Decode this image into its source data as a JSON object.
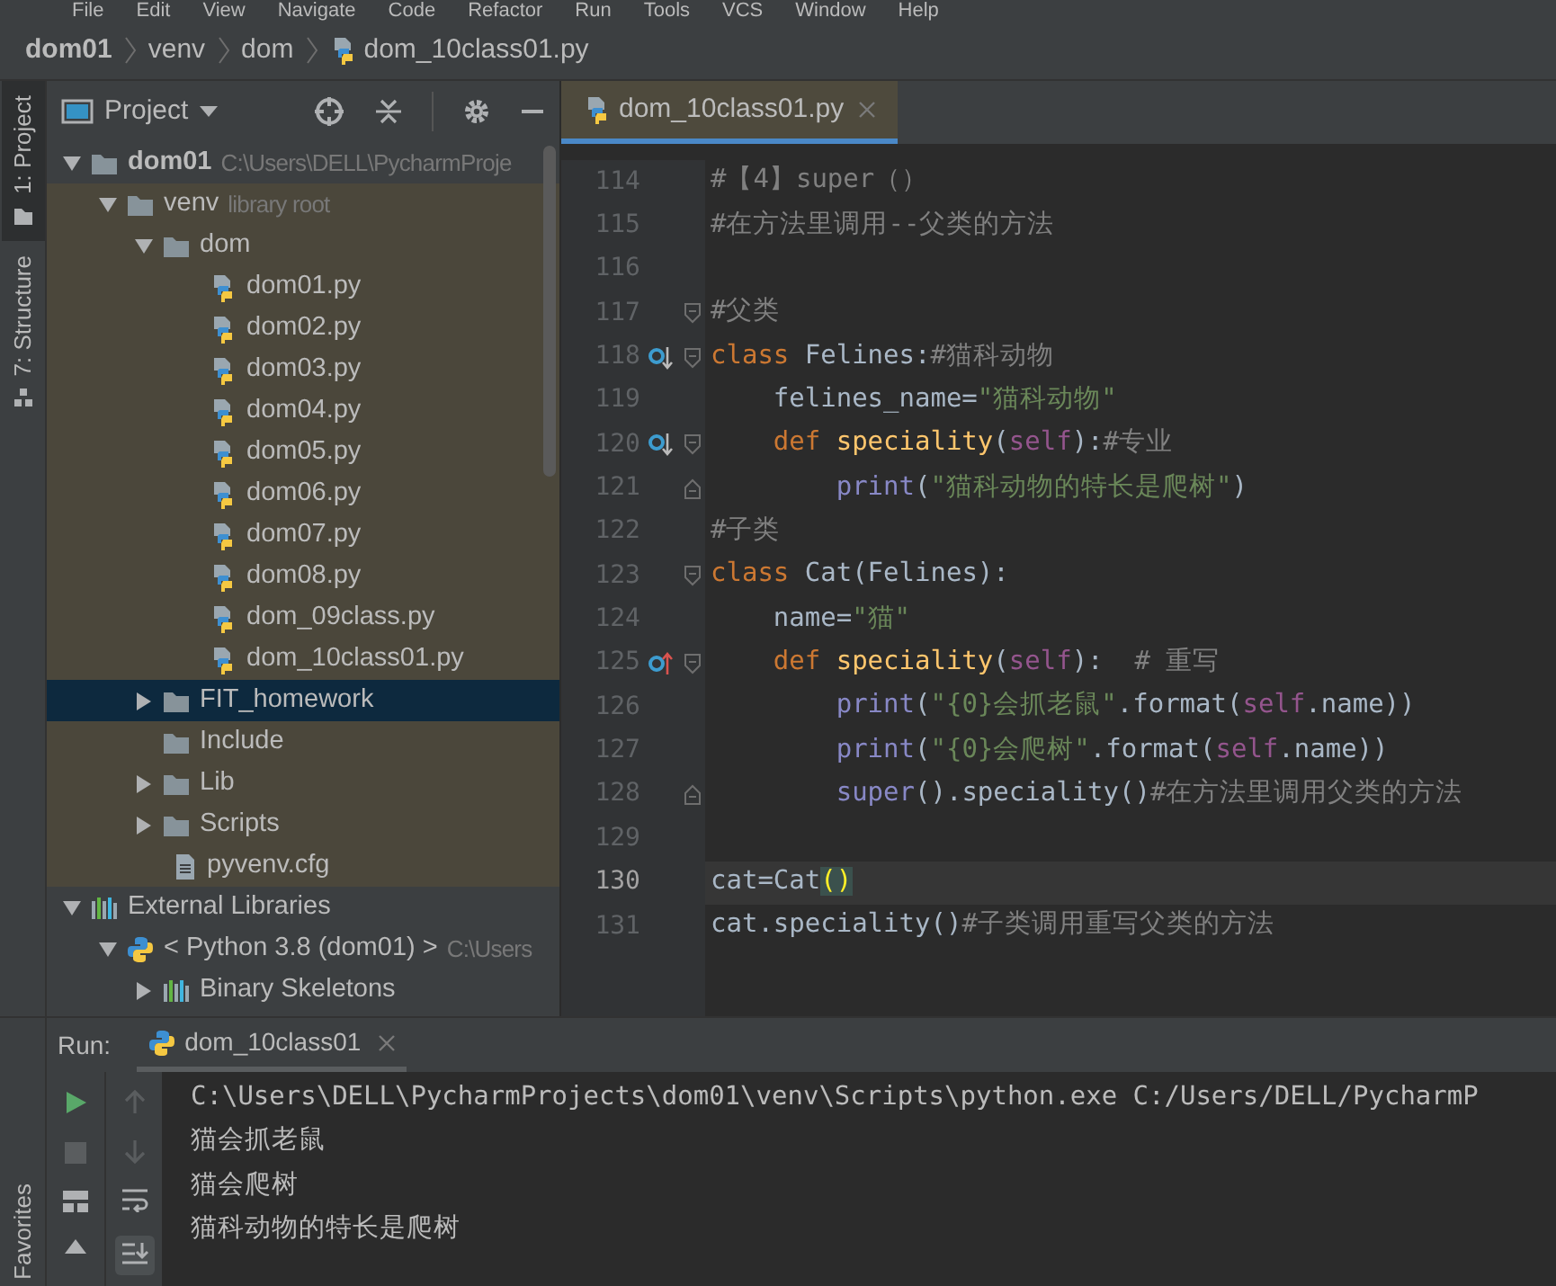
{
  "menu": [
    "File",
    "Edit",
    "View",
    "Navigate",
    "Code",
    "Refactor",
    "Run",
    "Tools",
    "VCS",
    "Window",
    "Help"
  ],
  "breadcrumbs": [
    {
      "text": "dom01",
      "kind": "project"
    },
    {
      "text": "venv",
      "kind": "folder"
    },
    {
      "text": "dom",
      "kind": "folder"
    },
    {
      "text": "dom_10class01.py",
      "kind": "python"
    }
  ],
  "tool_stripe": [
    {
      "label": "1: Project",
      "selected": true,
      "kind": "project"
    },
    {
      "label": "7: Structure",
      "selected": false,
      "kind": "structure"
    }
  ],
  "favorites_tab": {
    "label": "Favorites"
  },
  "project_panel": {
    "title": "Project",
    "tree": [
      {
        "label": "dom01",
        "hint": "C:\\Users\\DELL\\PycharmProje",
        "kind": "folder",
        "bold": true,
        "expanded": true,
        "children": [
          {
            "label": "venv",
            "hint": "library root",
            "kind": "folder",
            "library_root": true,
            "expanded": true,
            "children": [
              {
                "label": "dom",
                "kind": "folder",
                "expanded": true,
                "children": [
                  {
                    "label": "dom01.py",
                    "kind": "python"
                  },
                  {
                    "label": "dom02.py",
                    "kind": "python"
                  },
                  {
                    "label": "dom03.py",
                    "kind": "python"
                  },
                  {
                    "label": "dom04.py",
                    "kind": "python"
                  },
                  {
                    "label": "dom05.py",
                    "kind": "python"
                  },
                  {
                    "label": "dom06.py",
                    "kind": "python"
                  },
                  {
                    "label": "dom07.py",
                    "kind": "python"
                  },
                  {
                    "label": "dom08.py",
                    "kind": "python"
                  },
                  {
                    "label": "dom_09class.py",
                    "kind": "python"
                  },
                  {
                    "label": "dom_10class01.py",
                    "kind": "python"
                  }
                ]
              },
              {
                "label": "FIT_homework",
                "kind": "folder",
                "expanded": false,
                "selected": true
              },
              {
                "label": "Include",
                "kind": "folder"
              },
              {
                "label": "Lib",
                "kind": "folder",
                "expanded": false
              },
              {
                "label": "Scripts",
                "kind": "folder",
                "expanded": false
              },
              {
                "label": "pyvenv.cfg",
                "kind": "text"
              }
            ]
          }
        ]
      },
      {
        "label": "External Libraries",
        "kind": "library",
        "expanded": true,
        "children": [
          {
            "label": "< Python 3.8 (dom01) >",
            "hint": "C:\\Users",
            "kind": "sdk",
            "expanded": true,
            "children": [
              {
                "label": "Binary Skeletons",
                "kind": "library",
                "expanded": false
              }
            ]
          }
        ]
      }
    ]
  },
  "editor": {
    "tab": {
      "label": "dom_10class01.py",
      "selected": true
    },
    "lines": [
      {
        "number": "114",
        "tokens": [
          {
            "kind": "comment",
            "text": "#【4】super（）"
          }
        ]
      },
      {
        "number": "115",
        "tokens": [
          {
            "kind": "comment",
            "text": "#在方法里调用--父类的方法"
          }
        ]
      },
      {
        "number": "116"
      },
      {
        "number": "117",
        "fold_marker": {
          "kind": "start"
        },
        "tokens": [
          {
            "kind": "comment",
            "text": "#父类"
          }
        ]
      },
      {
        "number": "118",
        "fold_marker": {
          "kind": "start"
        },
        "gutter_marker": {
          "kind": "overridden"
        },
        "tokens": [
          {
            "kind": "keyword",
            "text": "class "
          },
          {
            "kind": "plain",
            "text": "Felines:"
          },
          {
            "kind": "comment",
            "text": "#猫科动物"
          }
        ]
      },
      {
        "number": "119",
        "tokens": [
          {
            "kind": "plain",
            "text": "    felines_name="
          },
          {
            "kind": "string",
            "text": "\"猫科动物\""
          }
        ]
      },
      {
        "number": "120",
        "fold_marker": {
          "kind": "start"
        },
        "gutter_marker": {
          "kind": "overridden"
        },
        "tokens": [
          {
            "kind": "keyword",
            "text": "    def "
          },
          {
            "kind": "function",
            "text": "speciality"
          },
          {
            "kind": "plain",
            "text": "("
          },
          {
            "kind": "self",
            "text": "self"
          },
          {
            "kind": "plain",
            "text": "):"
          },
          {
            "kind": "comment",
            "text": "#专业"
          }
        ]
      },
      {
        "number": "121",
        "fold_marker": {
          "kind": "end"
        },
        "tokens": [
          {
            "kind": "builtin",
            "text": "        print"
          },
          {
            "kind": "plain",
            "text": "("
          },
          {
            "kind": "string",
            "text": "\"猫科动物的特长是爬树\""
          },
          {
            "kind": "plain",
            "text": ")"
          }
        ]
      },
      {
        "number": "122",
        "tokens": [
          {
            "kind": "comment",
            "text": "#子类"
          }
        ]
      },
      {
        "number": "123",
        "fold_marker": {
          "kind": "start"
        },
        "tokens": [
          {
            "kind": "keyword",
            "text": "class "
          },
          {
            "kind": "plain",
            "text": "Cat(Felines):"
          }
        ]
      },
      {
        "number": "124",
        "tokens": [
          {
            "kind": "plain",
            "text": "    name="
          },
          {
            "kind": "string",
            "text": "\"猫\""
          }
        ]
      },
      {
        "number": "125",
        "fold_marker": {
          "kind": "start"
        },
        "gutter_marker": {
          "kind": "overrides"
        },
        "tokens": [
          {
            "kind": "keyword",
            "text": "    def "
          },
          {
            "kind": "function",
            "text": "speciality"
          },
          {
            "kind": "plain",
            "text": "("
          },
          {
            "kind": "self",
            "text": "self"
          },
          {
            "kind": "plain",
            "text": "):  "
          },
          {
            "kind": "comment",
            "text": "# 重写"
          }
        ]
      },
      {
        "number": "126",
        "tokens": [
          {
            "kind": "builtin",
            "text": "        print"
          },
          {
            "kind": "plain",
            "text": "("
          },
          {
            "kind": "string",
            "text": "\"{0}会抓老鼠\""
          },
          {
            "kind": "plain",
            "text": ".format("
          },
          {
            "kind": "self",
            "text": "self"
          },
          {
            "kind": "plain",
            "text": ".name))"
          }
        ]
      },
      {
        "number": "127",
        "tokens": [
          {
            "kind": "builtin",
            "text": "        print"
          },
          {
            "kind": "plain",
            "text": "("
          },
          {
            "kind": "string",
            "text": "\"{0}会爬树\""
          },
          {
            "kind": "plain",
            "text": ".format("
          },
          {
            "kind": "self",
            "text": "self"
          },
          {
            "kind": "plain",
            "text": ".name))"
          }
        ]
      },
      {
        "number": "128",
        "fold_marker": {
          "kind": "end"
        },
        "tokens": [
          {
            "kind": "builtin",
            "text": "        super"
          },
          {
            "kind": "plain",
            "text": "().speciality()"
          },
          {
            "kind": "comment",
            "text": "#在方法里调用父类的方法"
          }
        ]
      },
      {
        "number": "129"
      },
      {
        "number": "130",
        "current": true,
        "tokens": [
          {
            "kind": "plain",
            "text": "cat=Cat"
          },
          {
            "kind": "brace",
            "text": "()"
          }
        ]
      },
      {
        "number": "131",
        "tokens": [
          {
            "kind": "plain",
            "text": "cat.speciality()"
          },
          {
            "kind": "comment",
            "text": "#子类调用重写父类的方法"
          }
        ]
      }
    ]
  },
  "run_panel": {
    "label": "Run:",
    "tab": {
      "label": "dom_10class01",
      "selected": true
    },
    "output": [
      "C:\\Users\\DELL\\PycharmProjects\\dom01\\venv\\Scripts\\python.exe C:/Users/DELL/PycharmP",
      "猫会抓老鼠",
      "猫会爬树",
      "猫科动物的特长是爬树"
    ]
  }
}
